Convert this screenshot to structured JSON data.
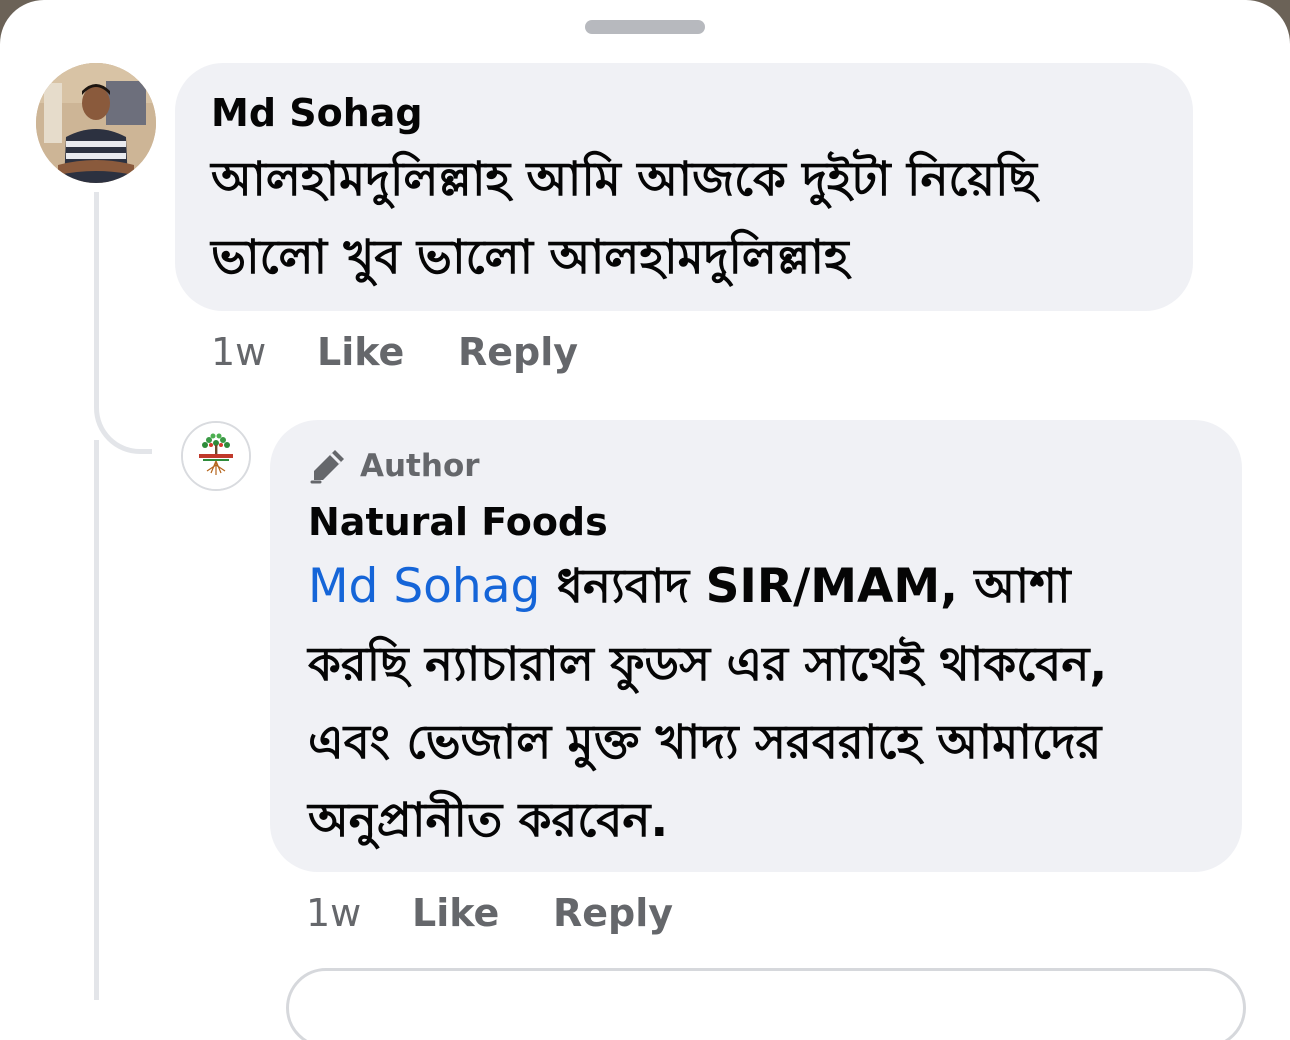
{
  "comments": [
    {
      "author": "Md Sohag",
      "text_line1": "আলহামদুলিল্লাহ আমি আজকে  দুইটা নিয়েছি",
      "text_line2": "ভালো খুব ভালো আলহামদুলিল্লাহ",
      "time": "1w",
      "like_label": "Like",
      "reply_label": "Reply"
    }
  ],
  "reply": {
    "badge_label": "Author",
    "badge_icon": "pencil-icon",
    "author": "Natural Foods",
    "mention": "Md Sohag",
    "line1_rest": " ধন্যবাদ SIR/MAM, আশা",
    "line2": "করছি ন্যাচারাল ফুডস এর সাথেই থাকবেন,",
    "line3": "এবং ভেজাল মুক্ত খাদ্য সরবরাহে আমাদের",
    "line4": "অনুপ্রানীত করবেন.",
    "time": "1w",
    "like_label": "Like",
    "reply_label": "Reply"
  },
  "colors": {
    "bubble": "#f0f1f5",
    "mention": "#1565d8",
    "secondary_text": "#65676b"
  }
}
